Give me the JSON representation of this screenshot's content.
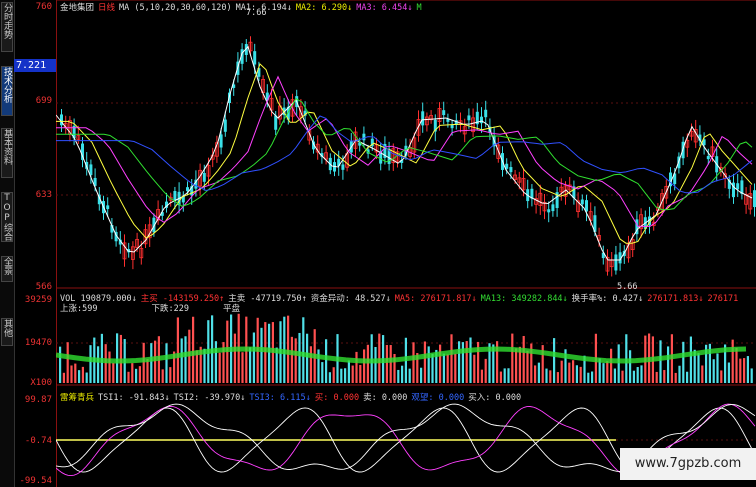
{
  "left_tabs": [
    "分时走势",
    "技术分析",
    "基本资料",
    "TOP综合",
    "全景",
    "其他"
  ],
  "axis": {
    "price_labels": [
      "760",
      "699",
      "633",
      "566"
    ],
    "current_price": "7.221",
    "vol_labels": [
      "39259",
      "19470",
      "X100"
    ],
    "osc_labels": [
      "99.87",
      "-0.74",
      "-99.54"
    ]
  },
  "header_price": {
    "stock": "金地集团",
    "period": "日线",
    "ma_def": "MA (5,10,20,30,60,120)",
    "ma1": "MA1: 6.194↓",
    "ma2": "MA2: 6.290↓",
    "ma3": "MA3: 6.454↓",
    "ma4": "M"
  },
  "header_vol": {
    "vol": "VOL 190879.000↓",
    "main_buy": "主买 -143159.250↑",
    "main_sell": "主卖 -47719.750↑",
    "fund_flow": "资金异动: 48.527↓",
    "ma5": "MA5: 276171.817↓",
    "ma13": "MA13: 349282.844↓",
    "turnover": "换手率%: 0.427↓",
    "ma5b": "276171.813↓",
    "ma5c": "276171"
  },
  "vol_sub": {
    "up": "上涨:599",
    "down": "下跌:229",
    "flat": "平盘"
  },
  "header_osc": {
    "name": "雷筹青兵",
    "tsi1": "TSI1: -91.843↓",
    "tsi2": "TSI2: -39.970↓",
    "tsi3": "TSI3: 6.115↓",
    "buy1": "买: 0.000",
    "sell": "卖: 0.000",
    "label3": "观望: 0.000",
    "buyin": "买入: 0.000"
  },
  "annotations": {
    "high": "7.66",
    "low": "5.66"
  },
  "watermark": "www.7gpzb.com"
}
